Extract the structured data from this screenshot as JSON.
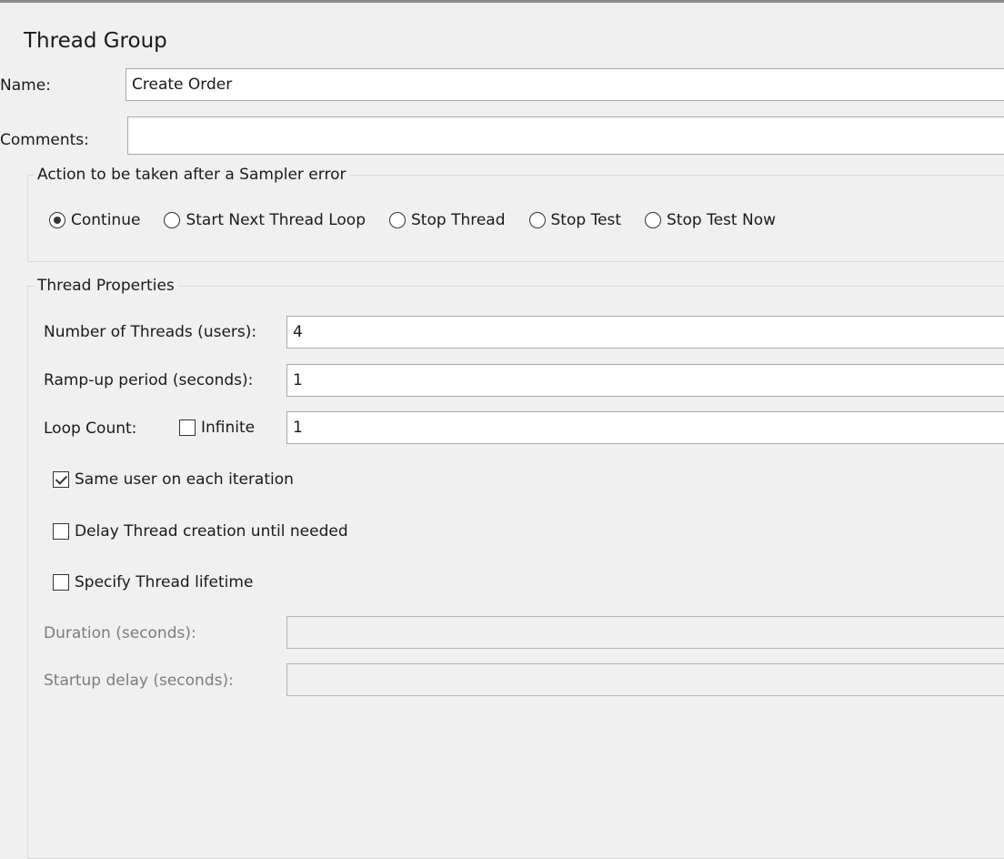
{
  "panel_title": "Thread Group",
  "name": {
    "label": "Name:",
    "value": "Create Order"
  },
  "comments": {
    "label": "Comments:",
    "value": ""
  },
  "sampler_error": {
    "legend": "Action to be taken after a Sampler error",
    "options": [
      "Continue",
      "Start Next Thread Loop",
      "Stop Thread",
      "Stop Test",
      "Stop Test Now"
    ],
    "selected": "Continue"
  },
  "thread_properties": {
    "legend": "Thread Properties",
    "num_threads": {
      "label": "Number of Threads (users):",
      "value": "4"
    },
    "ramp_up": {
      "label": "Ramp-up period (seconds):",
      "value": "1"
    },
    "loop_count": {
      "label": "Loop Count:",
      "infinite_label": "Infinite",
      "infinite_checked": false,
      "value": "1"
    },
    "same_user": {
      "label": "Same user on each iteration",
      "checked": true
    },
    "delay_creation": {
      "label": "Delay Thread creation until needed",
      "checked": false
    },
    "specify_lifetime": {
      "label": "Specify Thread lifetime",
      "checked": false
    },
    "duration": {
      "label": "Duration (seconds):",
      "value": ""
    },
    "startup_delay": {
      "label": "Startup delay (seconds):",
      "value": ""
    }
  }
}
